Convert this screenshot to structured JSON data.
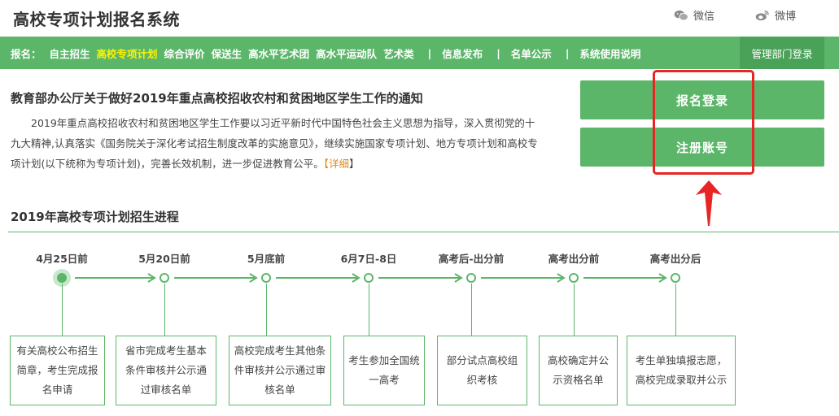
{
  "header": {
    "title": "高校专项计划报名系统",
    "wechat_label": "微信",
    "weibo_label": "微博"
  },
  "nav": {
    "prefix": "报名：",
    "items": [
      {
        "label": "自主招生",
        "active": false
      },
      {
        "label": "高校专项计划",
        "active": true
      },
      {
        "label": "综合评价",
        "active": false
      },
      {
        "label": "保送生",
        "active": false
      },
      {
        "label": "高水平艺术团",
        "active": false
      },
      {
        "label": "高水平运动队",
        "active": false
      },
      {
        "label": "艺术类",
        "active": false
      }
    ],
    "separator": "|",
    "links": [
      "信息发布",
      "名单公示",
      "系统使用说明"
    ],
    "admin_login": "管理部门登录"
  },
  "notice": {
    "title": "教育部办公厅关于做好2019年重点高校招收农村和贫困地区学生工作的通知",
    "body": "2019年重点高校招收农村和贫困地区学生工作要以习近平新时代中国特色社会主义思想为指导，深入贯彻党的十九大精神,认真落实《国务院关于深化考试招生制度改革的实施意见》，继续实施国家专项计划、地方专项计划和高校专项计划(以下统称为专项计划)，完善长效机制，进一步促进教育公平。",
    "more_open": "【",
    "more_label": "详细",
    "more_close": "】"
  },
  "actions": {
    "login": "报名登录",
    "register": "注册账号"
  },
  "progress": {
    "title": "2019年高校专项计划招生进程",
    "stages": [
      {
        "label": "4月25日前",
        "desc": "有关高校公布招生简章，考生完成报名申请",
        "current": true
      },
      {
        "label": "5月20日前",
        "desc": "省市完成考生基本条件审核并公示通过审核名单",
        "current": false
      },
      {
        "label": "5月底前",
        "desc": "高校完成考生其他条件审核并公示通过审核名单",
        "current": false
      },
      {
        "label": "6月7日-8日",
        "desc": "考生参加全国统一高考",
        "current": false
      },
      {
        "label": "高考后-出分前",
        "desc": "部分试点高校组织考核",
        "current": false
      },
      {
        "label": "高考出分前",
        "desc": "高校确定并公示资格名单",
        "current": false
      },
      {
        "label": "高考出分后",
        "desc": "考生单独填报志愿，高校完成录取并公示",
        "current": false
      }
    ]
  },
  "colors": {
    "accent": "#5cb66a",
    "active_nav": "#fff200",
    "highlight": "#e82424",
    "more_link": "#e08a1c"
  },
  "icons": {
    "wechat": "wechat-icon",
    "weibo": "weibo-icon"
  }
}
